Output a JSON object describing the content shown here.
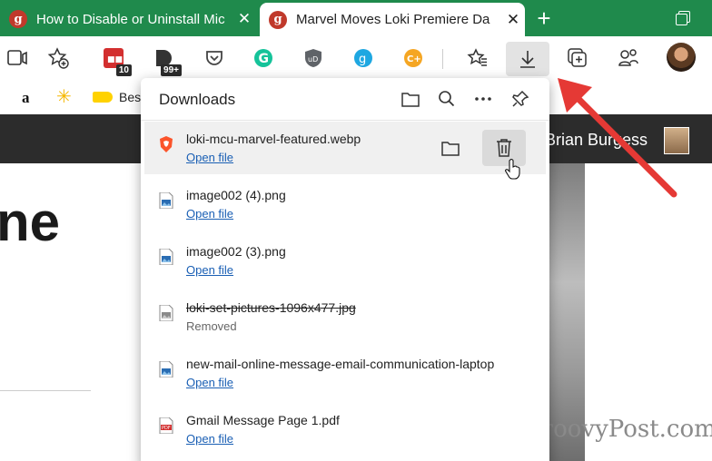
{
  "tabs": [
    {
      "title": "How to Disable or Uninstall Mic",
      "favicon": "g",
      "active": false
    },
    {
      "title": "Marvel Moves Loki Premiere Da",
      "favicon": "g",
      "active": true
    }
  ],
  "toolbar": {
    "badges": {
      "extension_1": "10",
      "extension_2": "99+"
    },
    "colors": {
      "accent_green": "#1f8a4c",
      "grammarly": "#15c39a",
      "gold": "#f5a623"
    }
  },
  "bookmarks": {
    "truncated_label": "Bes"
  },
  "page": {
    "author": "Brian Burgess",
    "headline_fragment": "ne",
    "watermark": "groovyPost.com"
  },
  "downloads": {
    "title": "Downloads",
    "items": [
      {
        "name": "loki-mcu-marvel-featured.webp",
        "action": "Open file",
        "icon": "brave-icon",
        "removed": false
      },
      {
        "name": "image002 (4).png",
        "action": "Open file",
        "icon": "image-file-icon",
        "removed": false
      },
      {
        "name": "image002 (3).png",
        "action": "Open file",
        "icon": "image-file-icon",
        "removed": false
      },
      {
        "name": "loki-set-pictures-1096x477.jpg",
        "status": "Removed",
        "icon": "image-file-icon",
        "removed": true
      },
      {
        "name": "new-mail-online-message-email-communication-laptop",
        "action": "Open file",
        "icon": "image-file-icon",
        "removed": false
      },
      {
        "name": "Gmail Message Page 1.pdf",
        "action": "Open file",
        "icon": "pdf-file-icon",
        "removed": false
      }
    ]
  },
  "annotation_color": "#e53935"
}
